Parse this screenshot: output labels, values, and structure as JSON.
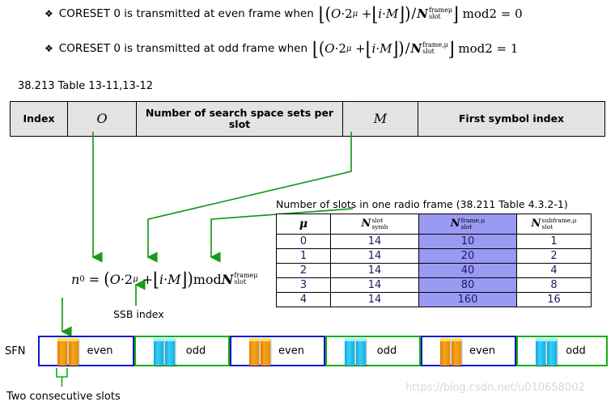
{
  "bullets": [
    {
      "marker": "❖",
      "text": "CORESET 0 is transmitted at even frame when",
      "formula": "⌊(O·2^μ + ⌊i·M⌋)/N_slot^frame,μ⌋ mod2 = 0",
      "mod_result": "0"
    },
    {
      "marker": "❖",
      "text": "CORESET 0 is transmitted at odd frame when",
      "formula": "⌊(O·2^μ + ⌊i·M⌋)/N_slot^frame,μ⌋ mod2 = 1",
      "mod_result": "1"
    }
  ],
  "spec_table": {
    "caption": "38.213 Table 13-11,13-12",
    "headers": [
      "Index",
      "O",
      "Number of search space sets per slot",
      "M",
      "First symbol index"
    ]
  },
  "slots_table": {
    "title": "Number of slots in one radio frame (38.211 Table 4.3.2-1)",
    "headers": [
      {
        "text": "μ",
        "sup": "",
        "sub": ""
      },
      {
        "text": "N",
        "sup": "slot",
        "sub": "symb"
      },
      {
        "text": "N",
        "sup": "frame,μ",
        "sub": "slot"
      },
      {
        "text": "N",
        "sup": "subframe,μ",
        "sub": "slot"
      }
    ],
    "highlight_column": 2,
    "highlight_color": "#9a9af5",
    "rows": [
      [
        "0",
        "14",
        "10",
        "1"
      ],
      [
        "1",
        "14",
        "20",
        "2"
      ],
      [
        "2",
        "14",
        "40",
        "4"
      ],
      [
        "3",
        "14",
        "80",
        "8"
      ],
      [
        "4",
        "14",
        "160",
        "16"
      ]
    ]
  },
  "formula": {
    "expression": "n₀ = (O·2^μ + ⌊i·M⌋) mod N_slot^frame,μ",
    "annotation_ssb": "SSB index"
  },
  "timeline": {
    "label": "SFN",
    "frames": [
      {
        "parity": "even",
        "marker": "orange"
      },
      {
        "parity": "odd",
        "marker": "cyan"
      },
      {
        "parity": "even",
        "marker": "orange"
      },
      {
        "parity": "odd",
        "marker": "cyan"
      },
      {
        "parity": "even",
        "marker": "orange"
      },
      {
        "parity": "odd",
        "marker": "cyan"
      }
    ],
    "annotation": "Two consecutive slots",
    "even_border_color": "#1414d0",
    "odd_border_color": "#10b010",
    "orange_color": "#f0940a",
    "cyan_color": "#1fc0ee"
  },
  "watermark": "https://blog.csdn.net/u010658002",
  "colors": {
    "arrow_green": "#1a9a1a",
    "table_header_bg": "#e3e3e3"
  }
}
